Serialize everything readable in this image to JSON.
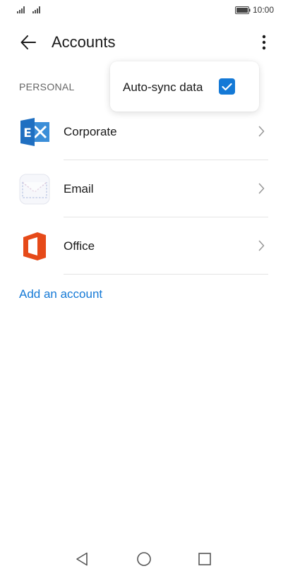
{
  "status_bar": {
    "time": "10:00",
    "signal_icon": "signal-icon",
    "battery_icon": "battery-icon"
  },
  "app_bar": {
    "title": "Accounts",
    "back_icon": "back-arrow-icon",
    "more_icon": "more-vert-icon"
  },
  "section": {
    "header": "PERSONAL"
  },
  "accounts": [
    {
      "label": "Corporate",
      "icon": "exchange-icon"
    },
    {
      "label": "Email",
      "icon": "email-envelope-icon"
    },
    {
      "label": "Office",
      "icon": "office-icon"
    }
  ],
  "add_account_label": "Add an account",
  "popup_menu": {
    "item_label": "Auto-sync data",
    "checked": true
  },
  "nav_bar": {
    "back_icon": "nav-back-icon",
    "home_icon": "nav-home-icon",
    "recents_icon": "nav-recents-icon"
  },
  "colors": {
    "accent": "#1479d6",
    "exchange_blue": "#1f6fc1",
    "office_orange": "#e64a19"
  }
}
